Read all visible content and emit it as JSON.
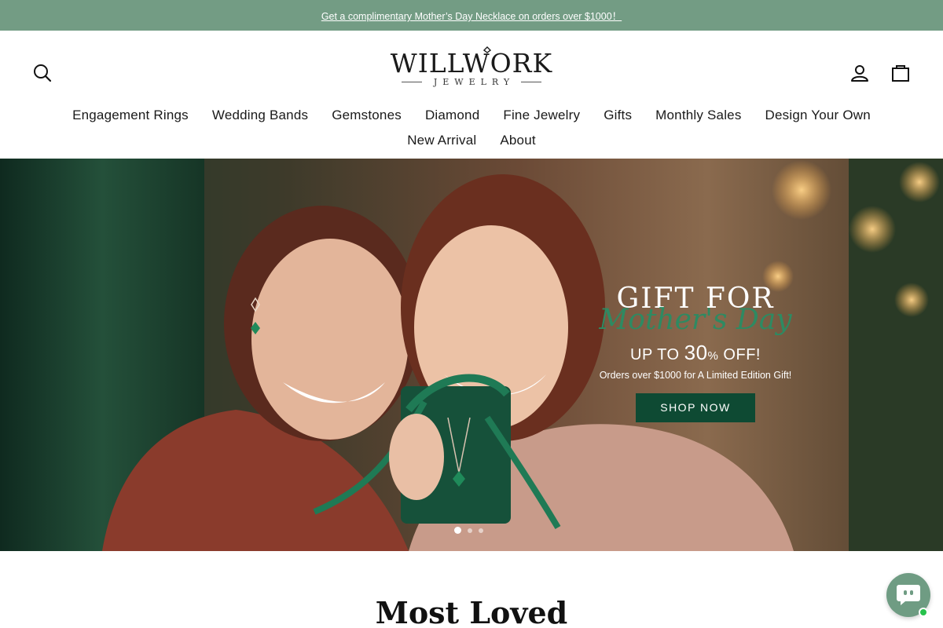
{
  "announcement": {
    "text": "Get a complimentary Mother’s Day Necklace on orders over $1000！"
  },
  "header": {
    "logo": {
      "main": "WILLWORK",
      "sub": "JEWELRY"
    },
    "icons": {
      "search": "search-icon",
      "account": "user-icon",
      "cart": "shopping-bag-icon"
    }
  },
  "nav": {
    "row1": [
      "Engagement Rings",
      "Wedding Bands",
      "Gemstones",
      "Diamond",
      "Fine Jewelry",
      "Gifts",
      "Monthly Sales",
      "Design Your Own"
    ],
    "row2": [
      "New Arrival",
      "About"
    ]
  },
  "hero": {
    "title": "GIFT FOR",
    "script": "Mother's Day",
    "discount_prefix": "UP TO ",
    "discount_value": "30",
    "discount_pct": "%",
    "discount_suffix": " OFF!",
    "subtitle": "Orders over $1000 for A Limited Edition Gift!",
    "cta": "SHOP NOW",
    "slides_total": 3,
    "active_slide": 1
  },
  "section": {
    "title": "Most Loved"
  },
  "colors": {
    "announcement_bg": "#739c84",
    "accent_green": "#0e4a33",
    "script_green": "#2e8a62",
    "chat_bg": "#6f9c83"
  }
}
